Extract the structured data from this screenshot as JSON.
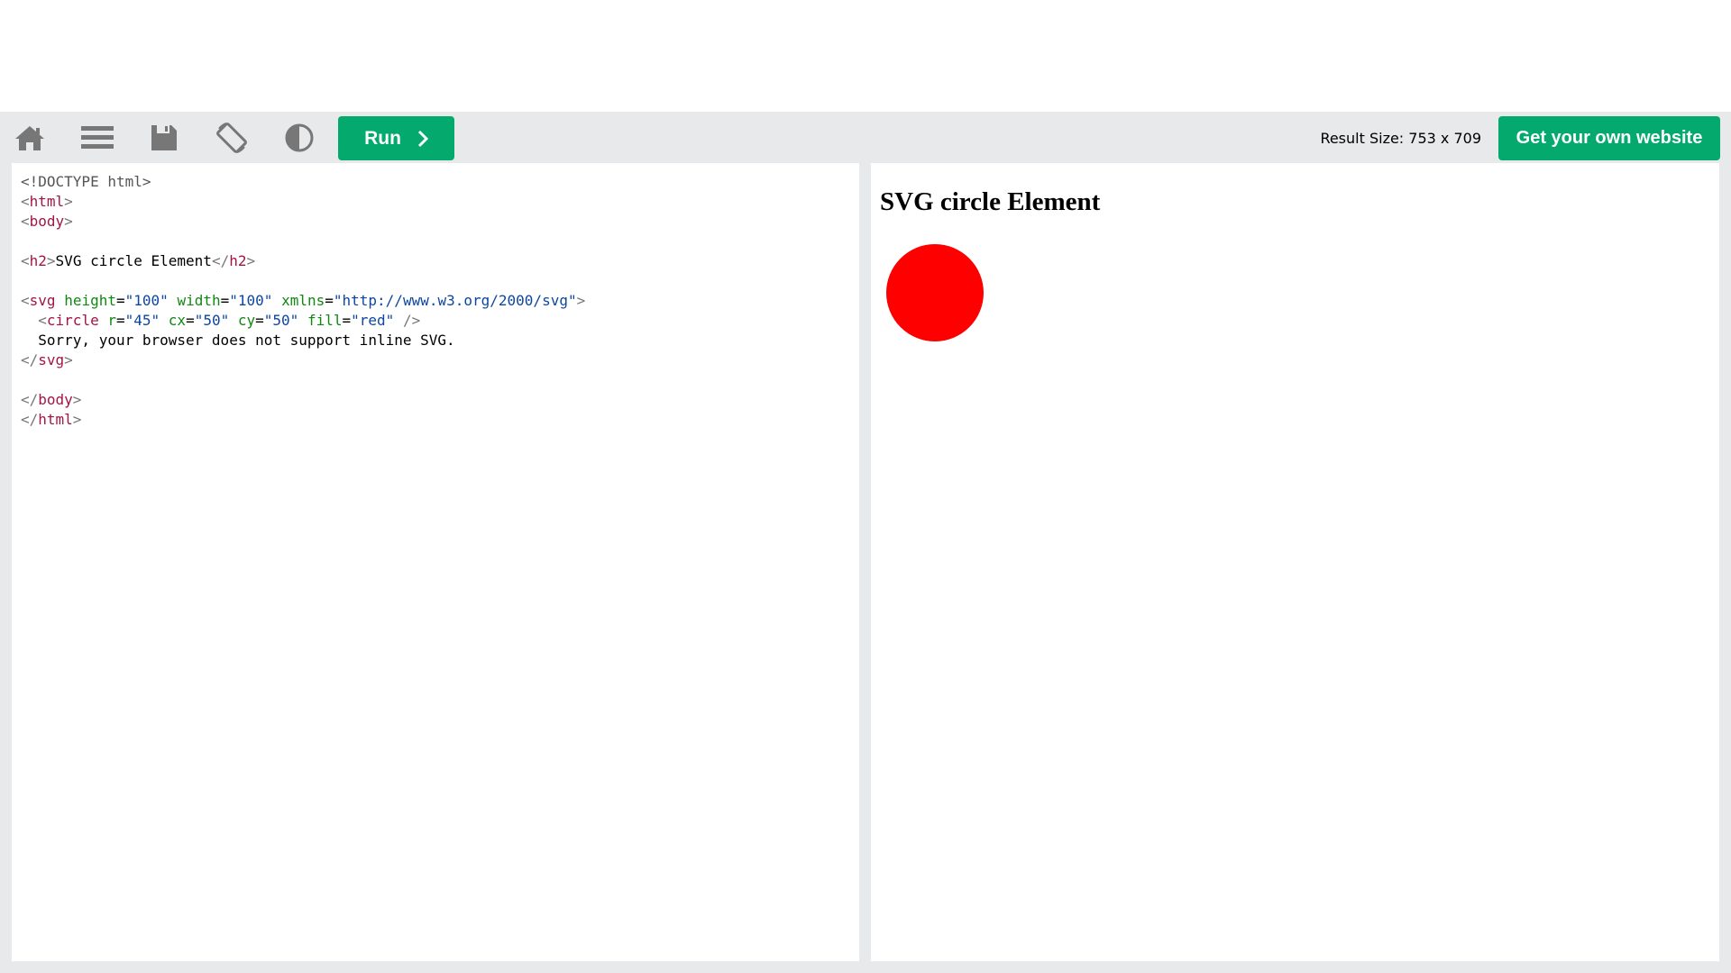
{
  "toolbar": {
    "icons": [
      "home-icon",
      "menu-icon",
      "save-icon",
      "rotate-icon",
      "contrast-icon"
    ],
    "run_label": "Run",
    "result_size_label": "Result Size: 753 x 709",
    "own_website_label": "Get your own website",
    "accent_color": "#04aa6d"
  },
  "editor": {
    "lines": [
      [
        {
          "t": "doc",
          "v": "<!DOCTYPE html>"
        }
      ],
      [
        {
          "t": "br",
          "v": "<"
        },
        {
          "t": "tag",
          "v": "html"
        },
        {
          "t": "br",
          "v": ">"
        }
      ],
      [
        {
          "t": "br",
          "v": "<"
        },
        {
          "t": "tag",
          "v": "body"
        },
        {
          "t": "br",
          "v": ">"
        }
      ],
      [],
      [
        {
          "t": "br",
          "v": "<"
        },
        {
          "t": "tag",
          "v": "h2"
        },
        {
          "t": "br",
          "v": ">"
        },
        {
          "t": "txt",
          "v": "SVG circle Element"
        },
        {
          "t": "br",
          "v": "</"
        },
        {
          "t": "tag",
          "v": "h2"
        },
        {
          "t": "br",
          "v": ">"
        }
      ],
      [],
      [
        {
          "t": "br",
          "v": "<"
        },
        {
          "t": "tag",
          "v": "svg"
        },
        {
          "t": "txt",
          "v": " "
        },
        {
          "t": "attr",
          "v": "height"
        },
        {
          "t": "txt",
          "v": "="
        },
        {
          "t": "val",
          "v": "\"100\""
        },
        {
          "t": "txt",
          "v": " "
        },
        {
          "t": "attr",
          "v": "width"
        },
        {
          "t": "txt",
          "v": "="
        },
        {
          "t": "val",
          "v": "\"100\""
        },
        {
          "t": "txt",
          "v": " "
        },
        {
          "t": "attr",
          "v": "xmlns"
        },
        {
          "t": "txt",
          "v": "="
        },
        {
          "t": "val",
          "v": "\"http://www.w3.org/2000/svg\""
        },
        {
          "t": "br",
          "v": ">"
        }
      ],
      [
        {
          "t": "txt",
          "v": "  "
        },
        {
          "t": "br",
          "v": "<"
        },
        {
          "t": "tag",
          "v": "circle"
        },
        {
          "t": "txt",
          "v": " "
        },
        {
          "t": "attr",
          "v": "r"
        },
        {
          "t": "txt",
          "v": "="
        },
        {
          "t": "val",
          "v": "\"45\""
        },
        {
          "t": "txt",
          "v": " "
        },
        {
          "t": "attr",
          "v": "cx"
        },
        {
          "t": "txt",
          "v": "="
        },
        {
          "t": "val",
          "v": "\"50\""
        },
        {
          "t": "txt",
          "v": " "
        },
        {
          "t": "attr",
          "v": "cy"
        },
        {
          "t": "txt",
          "v": "="
        },
        {
          "t": "val",
          "v": "\"50\""
        },
        {
          "t": "txt",
          "v": " "
        },
        {
          "t": "attr",
          "v": "fill"
        },
        {
          "t": "txt",
          "v": "="
        },
        {
          "t": "val",
          "v": "\"red\""
        },
        {
          "t": "txt",
          "v": " "
        },
        {
          "t": "br",
          "v": "/>"
        }
      ],
      [
        {
          "t": "txt",
          "v": "  Sorry, your browser does not support inline SVG."
        }
      ],
      [
        {
          "t": "br",
          "v": "</"
        },
        {
          "t": "tag",
          "v": "svg"
        },
        {
          "t": "br",
          "v": ">"
        }
      ],
      [],
      [
        {
          "t": "br",
          "v": "</"
        },
        {
          "t": "tag",
          "v": "body"
        },
        {
          "t": "br",
          "v": ">"
        }
      ],
      [
        {
          "t": "br",
          "v": "</"
        },
        {
          "t": "tag",
          "v": "html"
        },
        {
          "t": "br",
          "v": ">"
        }
      ]
    ]
  },
  "result": {
    "heading": "SVG circle Element",
    "circle_fill": "#ff0000"
  }
}
